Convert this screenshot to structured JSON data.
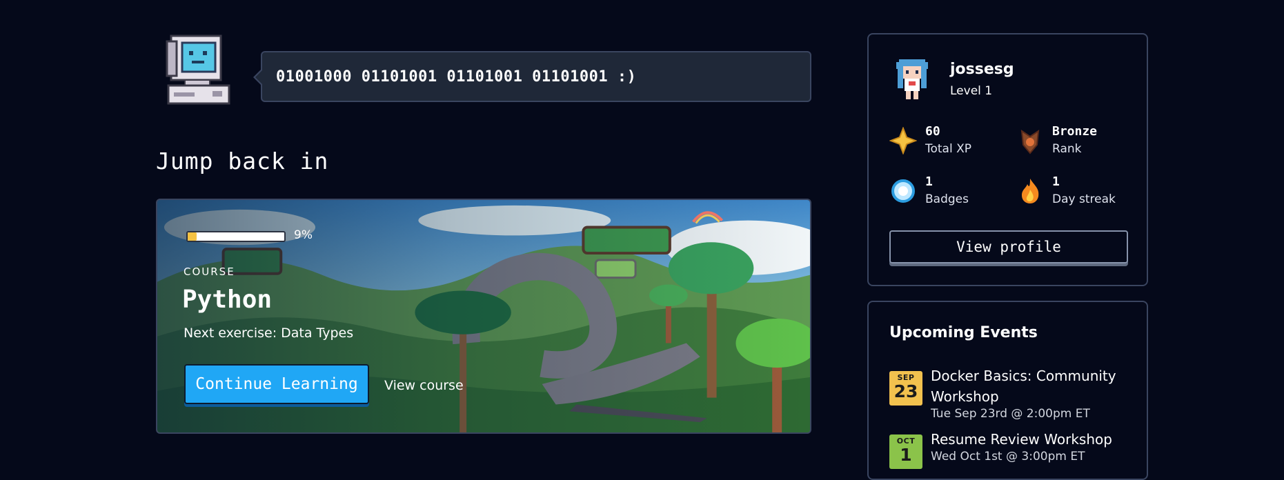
{
  "greeting": {
    "binary_message": "01001000 01101001 01101001 01101001 :)"
  },
  "jump_back_in": {
    "title": "Jump back in"
  },
  "course": {
    "progress_percent": 9,
    "progress_label": "9%",
    "kicker": "COURSE",
    "name": "Python",
    "next_exercise": "Next exercise: Data Types",
    "continue_label": "Continue Learning",
    "view_course_label": "View course"
  },
  "profile": {
    "username": "jossesg",
    "level": "Level 1",
    "stats": [
      {
        "value": "60",
        "label": "Total XP",
        "icon": "xp-star-icon"
      },
      {
        "value": "Bronze",
        "label": "Rank",
        "icon": "bronze-rank-icon"
      },
      {
        "value": "1",
        "label": "Badges",
        "icon": "badge-gem-icon"
      },
      {
        "value": "1",
        "label": "Day streak",
        "icon": "flame-icon"
      }
    ],
    "view_profile_label": "View profile"
  },
  "events": {
    "title": "Upcoming Events",
    "items": [
      {
        "month": "SEP",
        "day": "23",
        "title": "Docker Basics: Community Workshop",
        "time": "Tue Sep 23rd @ 2:00pm ET",
        "badge_color": "#f2c14e"
      },
      {
        "month": "OCT",
        "day": "1",
        "title": "Resume Review Workshop",
        "time": "Wed Oct 1st @ 3:00pm ET",
        "badge_color": "#8bc34a"
      }
    ]
  },
  "colors": {
    "background": "#05091a",
    "accent_blue": "#20a7f5",
    "card_border": "#3a4560",
    "progress_fill": "#f5c242"
  }
}
